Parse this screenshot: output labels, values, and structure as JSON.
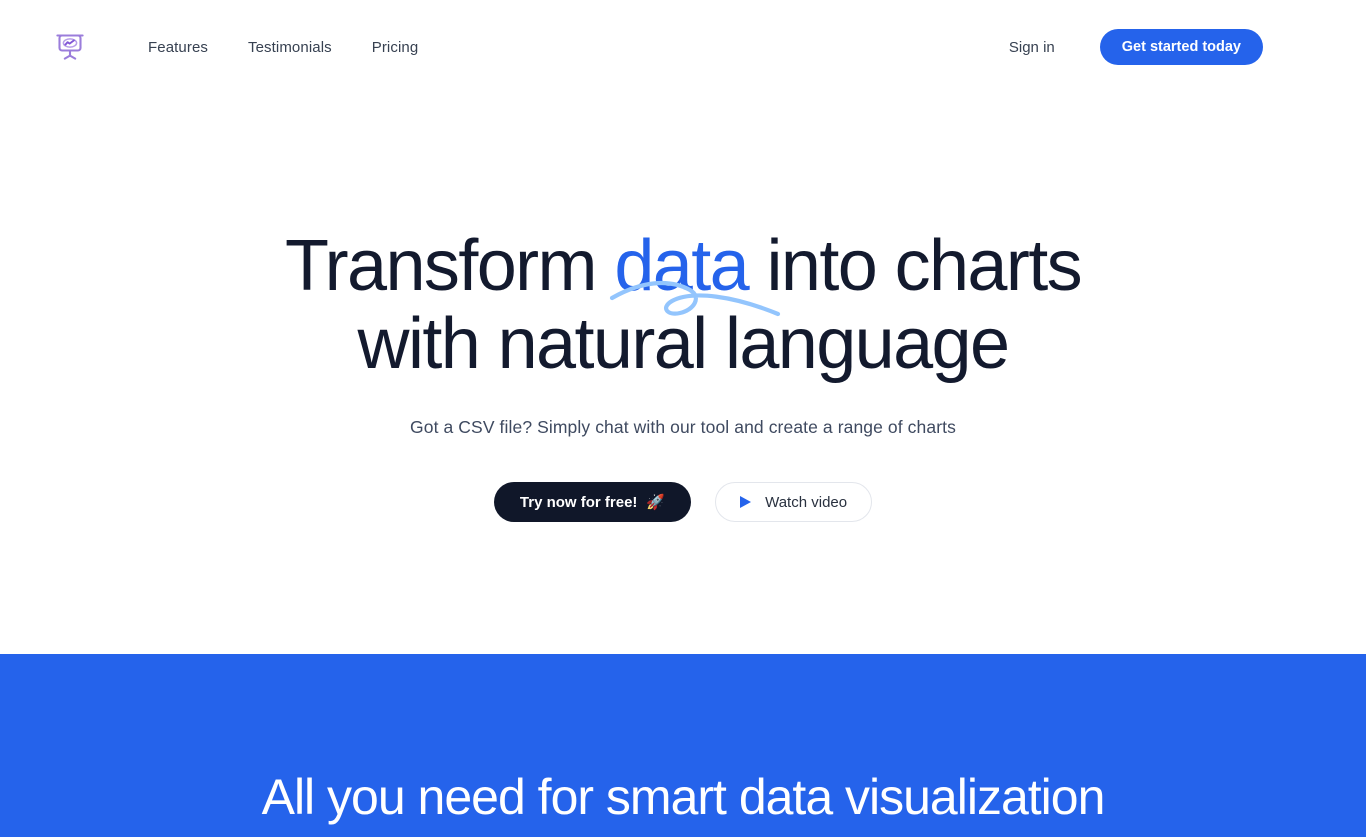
{
  "header": {
    "logo": {
      "icon": "presentation-chart-icon",
      "color": "#8b5cf6"
    },
    "nav": [
      {
        "label": "Features"
      },
      {
        "label": "Testimonials"
      },
      {
        "label": "Pricing"
      }
    ],
    "signin_label": "Sign in",
    "cta_label": "Get started today"
  },
  "hero": {
    "title_part1": "Transform ",
    "title_highlight": "data",
    "title_part2": " into charts",
    "title_line2": "with natural language",
    "subtitle": "Got a CSV file? Simply chat with our tool and create a range of charts",
    "primary_button": {
      "label": "Try now for free!",
      "emoji": "🚀",
      "icon": "rocket-icon"
    },
    "secondary_button": {
      "label": "Watch video",
      "icon": "play-icon"
    }
  },
  "features_section": {
    "heading": "All you need for smart data visualization"
  },
  "colors": {
    "brand_blue": "#2563eb",
    "highlight_blue": "#2563eb",
    "swoosh_blue": "#93c5fd",
    "dark_button": "#101729",
    "logo_purple": "#8b5cf6",
    "heading_dark": "#131a2e",
    "body_text": "#3f4a60",
    "nav_text": "#374151",
    "section_white": "#ffffff"
  }
}
